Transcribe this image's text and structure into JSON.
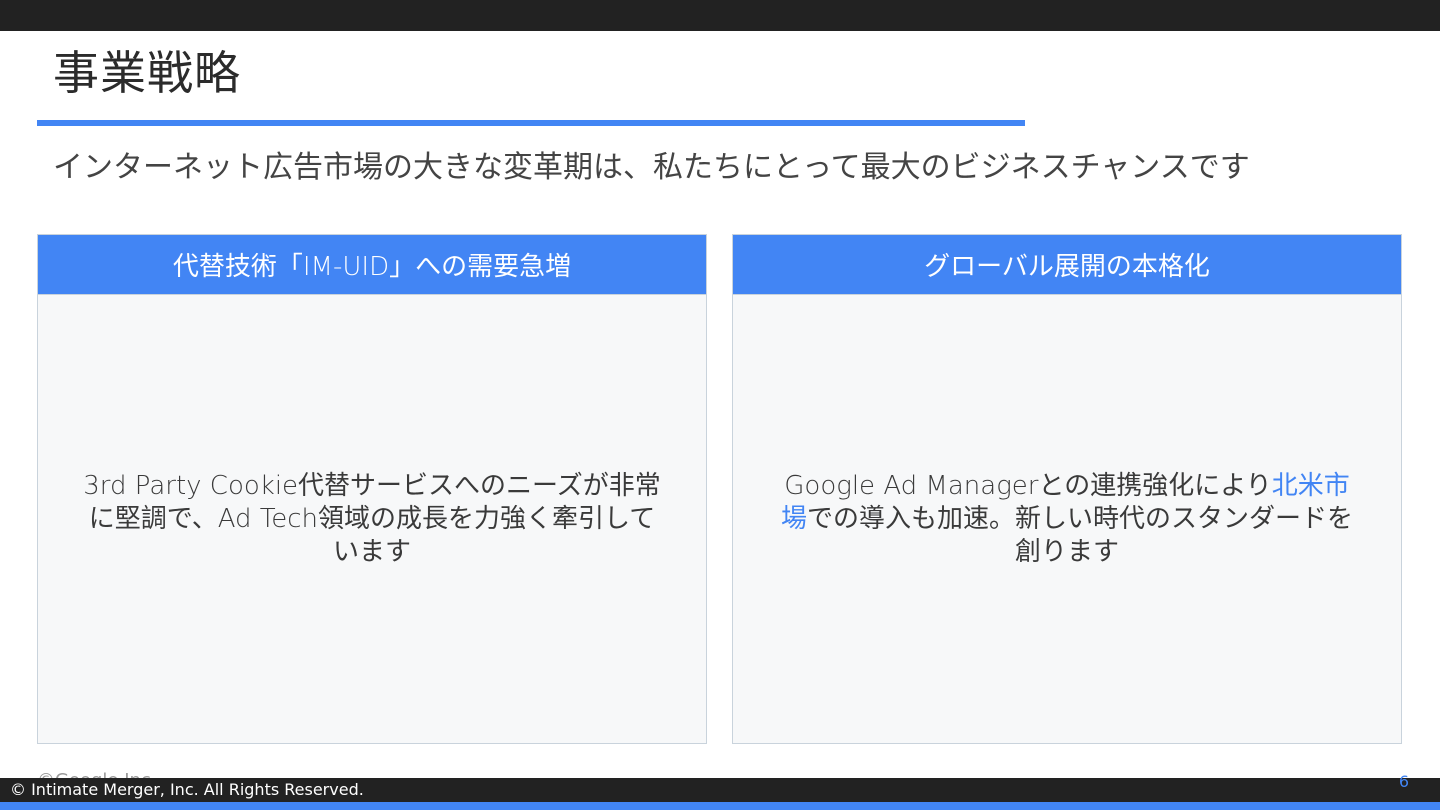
{
  "slide": {
    "title": "事業戦略",
    "subtitle": "インターネット広告市場の大きな変革期は、私たちにとって最大のビジネスチャンスです",
    "page_number": "6"
  },
  "cards": [
    {
      "header": "代替技術「IM-UID」への需要急増",
      "body": "3rd Party Cookie代替サービスへのニーズが非常に堅調で、Ad Tech領域の成長を力強く牽引しています"
    },
    {
      "header": "グローバル展開の本格化",
      "body_before": "Google Ad Managerとの連携強化により",
      "body_highlight": "北米市場",
      "body_after": "での導入も加速。新しい時代のスタンダードを創ります"
    }
  ],
  "footer": {
    "source_label": "©Google Inc.",
    "copyright": "© Intimate Merger, Inc. All Rights Reserved."
  },
  "colors": {
    "accent": "#4285f4",
    "dark_bar": "#222222",
    "card_bg": "#f7f8f9"
  }
}
